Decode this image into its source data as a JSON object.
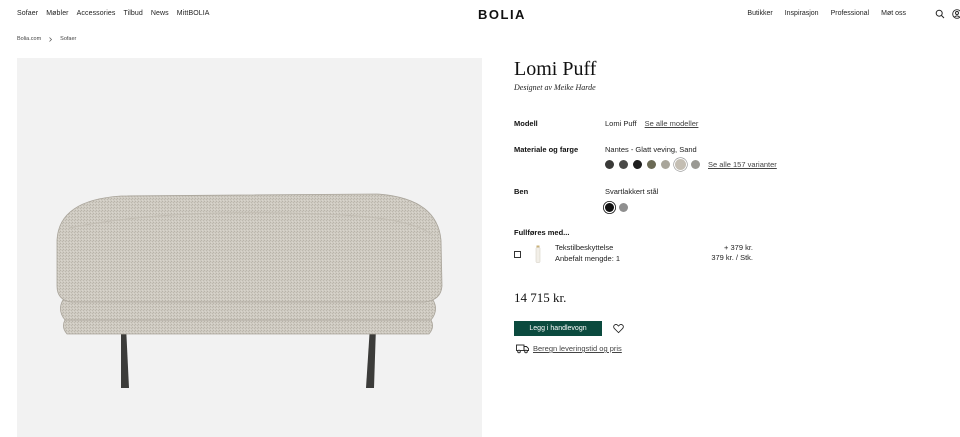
{
  "nav": {
    "left_items": [
      "Sofaer",
      "Møbler",
      "Accessories",
      "Tilbud",
      "News",
      "MittBOLIA"
    ],
    "logo": "BOLIA",
    "right_items": [
      "Butikker",
      "Inspirasjon",
      "Professional",
      "Møt oss"
    ],
    "icons": [
      "search-icon",
      "user-icon"
    ]
  },
  "breadcrumb": {
    "items": [
      "Bolia.com",
      "Sofaer"
    ]
  },
  "product": {
    "title": "Lomi Puff",
    "designer": "Designet av Meike Harde",
    "model_label": "Modell",
    "model_value": "Lomi Puff",
    "model_link": "Se alle modeller",
    "material_label": "Materiale og farge",
    "material_value": "Nantes - Glatt veving, Sand",
    "material_link": "Se alle 157 varianter",
    "material_swatches": [
      "#3a3a38",
      "#4a4a48",
      "#1e1e1e",
      "#6b6a55",
      "#a9a69b",
      "#c4beb3",
      "#9a9993"
    ],
    "material_selected_index": 5,
    "legs_label": "Ben",
    "legs_value": "Svartlakkert stål",
    "legs_swatches": [
      "#111111",
      "#8f8f8f"
    ],
    "legs_selected_index": 0,
    "complete_label": "Fullføres med...",
    "addon_name": "Tekstilbeskyttelse",
    "addon_recommended": "Anbefalt mengde: 1",
    "addon_price": "+ 379 kr.",
    "addon_unit_price": "379 kr. / Stk.",
    "price": "14 715 kr.",
    "add_to_cart": "Legg i handlevogn",
    "delivery_link": "Beregn leveringstid og pris"
  },
  "colors": {
    "accent": "#0b4a3e",
    "image_bg": "#f2f2f2"
  }
}
